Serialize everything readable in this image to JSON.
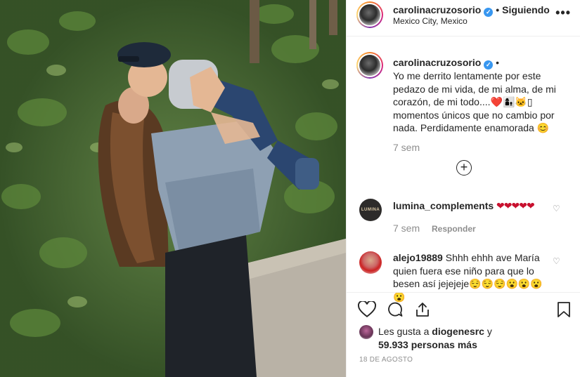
{
  "post": {
    "username": "carolinacruzosorio",
    "verified_glyph": "✓",
    "dot": "•",
    "follow_status": "Siguiendo",
    "location": "Mexico City, Mexico",
    "more_icon": "•••"
  },
  "caption": {
    "username": "carolinacruzosorio",
    "text_line1": "Yo me derrito lentamente por este pedazo de mi vida, de mi alma, de mi corazón, de mi todo....",
    "emojis": "❤️👩‍👦🐱▯",
    "text_line2": "momentos únicos que no cambio por nada. Perdidamente enamorada",
    "smile": "😊",
    "time": "7 sem",
    "expand_icon": "+"
  },
  "comments": [
    {
      "username": "lumina_complements",
      "avatar_text": "LUMINA",
      "text": "❤❤❤❤❤",
      "time": "7 sem",
      "reply_label": "Responder"
    },
    {
      "username": "alejo19889",
      "text": "Shhh ehhh ave María quien fuera ese niño para que lo besen así jejejeje",
      "emojis": "😌😌😌😮😮😮😮"
    }
  ],
  "likes": {
    "prefix": "Les gusta a",
    "user": "diogenesrc",
    "conjunction": "y",
    "count": "59.933 personas más"
  },
  "date": "18 DE AGOSTO",
  "colors": {
    "accent": "#3897f0",
    "text": "#262626",
    "muted": "#8e8e8e",
    "heart": "#c8102e"
  }
}
